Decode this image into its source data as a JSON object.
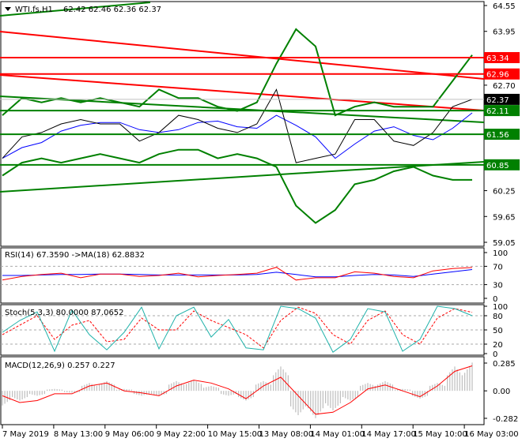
{
  "header": {
    "symbol_label": "WTI.fs,H1",
    "ohlc": "62.42 62.46 62.36 62.37"
  },
  "colors": {
    "resistance": "#ff0000",
    "support": "#008000",
    "price_box": "#000000",
    "rsi": "#ff0000",
    "rsi_ma": "#0000ff",
    "stoch_main": "#20b2aa",
    "stoch_signal": "#ff0000",
    "macd_hist": "#b0b0b0",
    "macd_signal": "#ff0000"
  },
  "chart_data": [
    {
      "type": "line",
      "title": "WTI.fs,H1",
      "y_ticks": [
        "64.55",
        "63.95",
        "62.70",
        "60.25",
        "59.65",
        "59.05"
      ],
      "ylim": [
        59.05,
        64.55
      ],
      "current_price": {
        "value": 62.37,
        "label": "62.37"
      },
      "levels": [
        {
          "value": 63.34,
          "label": "63.34",
          "kind": "resistance"
        },
        {
          "value": 62.96,
          "label": "62.96",
          "kind": "resistance"
        },
        {
          "value": 62.11,
          "label": "62.11",
          "kind": "support"
        },
        {
          "value": 61.56,
          "label": "61.56",
          "kind": "support"
        },
        {
          "value": 60.85,
          "label": "60.85",
          "kind": "support"
        }
      ],
      "close": [
        61.0,
        61.5,
        61.6,
        61.8,
        61.9,
        61.8,
        61.8,
        61.4,
        61.6,
        62.0,
        61.9,
        61.7,
        61.6,
        61.8,
        62.6,
        60.9,
        61.0,
        61.1,
        61.9,
        61.9,
        61.4,
        61.3,
        61.6,
        62.2,
        62.37
      ],
      "bb_upper": [
        62.0,
        62.4,
        62.3,
        62.4,
        62.3,
        62.4,
        62.3,
        62.2,
        62.6,
        62.4,
        62.4,
        62.2,
        62.1,
        62.3,
        63.2,
        64.0,
        63.6,
        62.0,
        62.2,
        62.3,
        62.2,
        62.2,
        62.2,
        62.8,
        63.4
      ],
      "bb_lower": [
        60.6,
        60.9,
        61.0,
        60.9,
        61.0,
        61.1,
        61.0,
        60.9,
        61.1,
        61.2,
        61.2,
        61.0,
        61.1,
        61.0,
        60.8,
        59.9,
        59.5,
        59.8,
        60.4,
        60.5,
        60.7,
        60.8,
        60.6,
        60.5,
        60.5
      ]
    },
    {
      "type": "line",
      "title": "RSI(14) 67.3590  ->MA(18) 62.8832",
      "y_ticks": [
        "100",
        "70",
        "30",
        "0"
      ],
      "ylim": [
        0,
        100
      ],
      "rsi": [
        40,
        48,
        52,
        55,
        45,
        53,
        53,
        48,
        50,
        55,
        47,
        50,
        52,
        55,
        68,
        40,
        45,
        45,
        58,
        55,
        48,
        45,
        60,
        65,
        67.4
      ],
      "ma": [
        50,
        50,
        51,
        52,
        52,
        53,
        53,
        52,
        51,
        51,
        51,
        51,
        51,
        52,
        57,
        52,
        47,
        47,
        50,
        52,
        51,
        48,
        53,
        58,
        62.9
      ]
    },
    {
      "type": "line",
      "title": "Stoch(5,3,3) 80.0000 87.0652",
      "y_ticks": [
        "100",
        "80",
        "50",
        "20",
        "0"
      ],
      "ylim": [
        0,
        100
      ],
      "main": [
        45,
        70,
        88,
        5,
        92,
        40,
        8,
        45,
        98,
        10,
        80,
        98,
        35,
        72,
        12,
        8,
        100,
        95,
        75,
        3,
        30,
        95,
        88,
        5,
        30,
        100,
        95,
        80
      ],
      "signal": [
        40,
        60,
        80,
        30,
        60,
        70,
        25,
        30,
        75,
        50,
        50,
        90,
        70,
        55,
        40,
        12,
        70,
        98,
        85,
        40,
        20,
        70,
        90,
        40,
        20,
        75,
        95,
        87.1
      ]
    },
    {
      "type": "bar",
      "title": "MACD(12,26,9) 0.257 0.227",
      "y_ticks": [
        "0.285",
        "0.00",
        "-0.282"
      ],
      "ylim": [
        -0.282,
        0.285
      ],
      "hist": [
        -0.15,
        -0.1,
        -0.05,
        0.02,
        -0.02,
        0.08,
        0.1,
        0.02,
        -0.05,
        -0.05,
        0.1,
        0.11,
        0.05,
        -0.05,
        -0.1,
        0.1,
        0.25,
        -0.25,
        -0.28,
        -0.2,
        -0.1,
        0.08,
        0.1,
        0.02,
        -0.08,
        0.08,
        0.25,
        0.29
      ],
      "signal": [
        -0.05,
        -0.12,
        -0.1,
        -0.03,
        -0.03,
        0.05,
        0.08,
        0.0,
        -0.02,
        -0.05,
        0.05,
        0.11,
        0.08,
        0.02,
        -0.08,
        0.05,
        0.14,
        -0.05,
        -0.24,
        -0.22,
        -0.12,
        0.02,
        0.06,
        0.0,
        -0.06,
        0.05,
        0.2,
        0.257
      ]
    }
  ],
  "x_labels": [
    "7 May 2019",
    "8 May 13:00",
    "9 May 06:00",
    "9 May 22:00",
    "10 May 15:00",
    "13 May 08:00",
    "14 May 01:00",
    "14 May 17:00",
    "15 May 10:00",
    "16 May 03:00"
  ]
}
